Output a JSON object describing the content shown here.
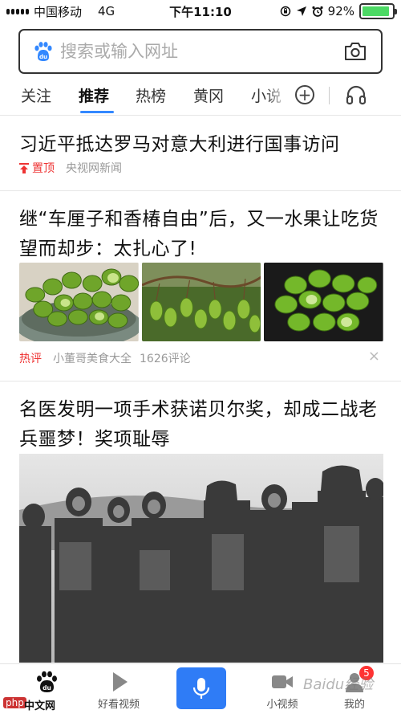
{
  "status_bar": {
    "carrier": "中国移动",
    "network": "4G",
    "time": "下午11:10",
    "battery_percent": "92%",
    "battery_level": 0.92,
    "icons": [
      "orientation-lock-icon",
      "location-icon",
      "alarm-icon"
    ]
  },
  "search": {
    "placeholder": "搜索或输入网址",
    "icons": [
      "baidu-paw-icon",
      "camera-icon"
    ]
  },
  "tabs": [
    {
      "label": "关注"
    },
    {
      "label": "推荐",
      "active": true
    },
    {
      "label": "热榜"
    },
    {
      "label": "黄冈"
    },
    {
      "label": "小说"
    }
  ],
  "feed": [
    {
      "title": "习近平抵达罗马对意大利进行国事访问",
      "tag": "置顶",
      "source": "央视网新闻"
    },
    {
      "title": "继“车厘子和香椿自由”后，又一水果让吃货望而却步：太扎心了!",
      "tag": "热评",
      "source": "小董哥美食大全",
      "comments": "1626评论",
      "close": "×"
    },
    {
      "title": "名医发明一项手术获诺贝尔奖，却成二战老兵噩梦！奖项耻辱"
    }
  ],
  "bottom_nav": [
    {
      "label": "",
      "icon": "baidu-home-icon"
    },
    {
      "label": "好看视频",
      "icon": "play-icon"
    },
    {
      "label": "",
      "icon": "microphone-icon"
    },
    {
      "label": "小视频",
      "icon": "video-camera-icon"
    },
    {
      "label": "我的",
      "icon": "profile-icon",
      "badge": "5"
    }
  ],
  "overlay": {
    "watermark": "Baidu经验",
    "site_logo_php": "php",
    "site_logo_cn": "中文网"
  },
  "colors": {
    "accent": "#3388ff",
    "mic_button": "#2f7cf6",
    "hot_red": "#e33333",
    "battery_green": "#4cd964"
  }
}
